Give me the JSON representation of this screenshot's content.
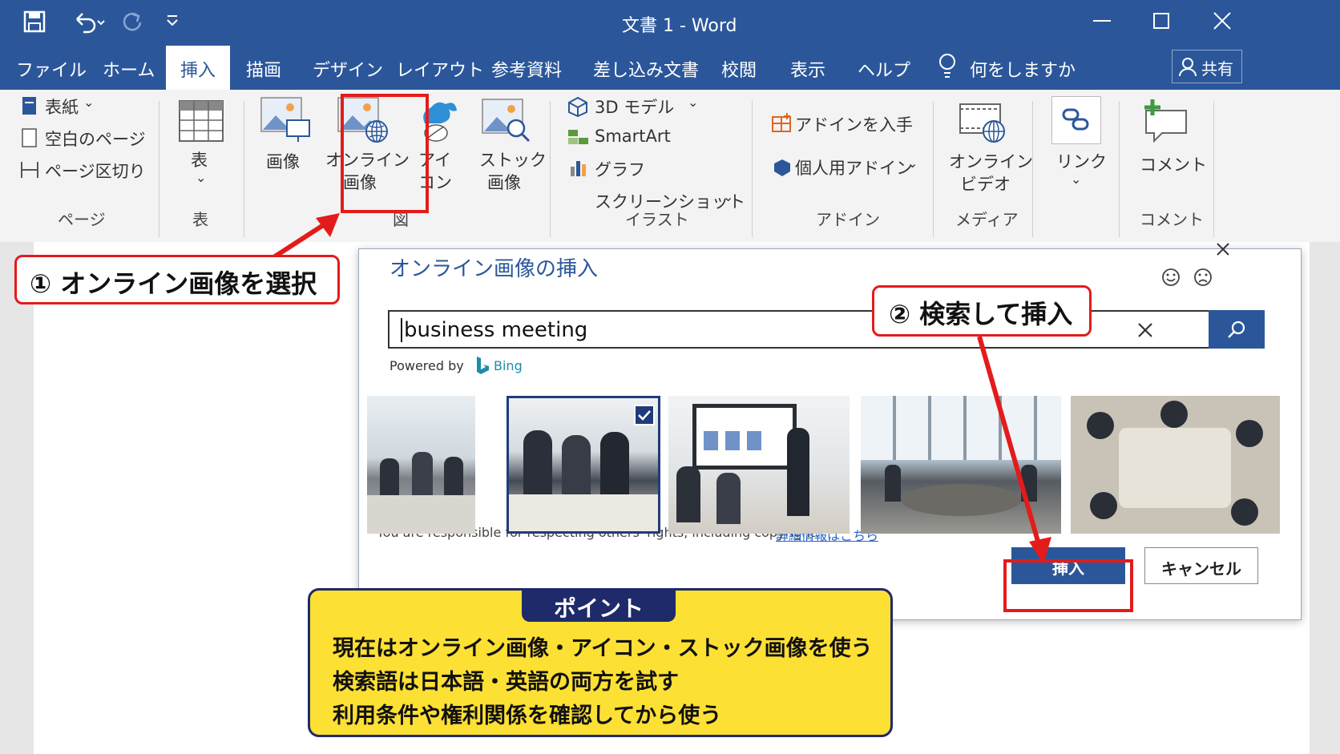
{
  "window": {
    "title": "文書 1  -  Word"
  },
  "tabs": [
    "ファイル",
    "ホーム",
    "挿入",
    "描画",
    "デザイン",
    "レイアウト",
    "参考資料",
    "差し込み文書",
    "校閲",
    "表示",
    "ヘルプ"
  ],
  "tell_me": "何をしますか",
  "share": "共有",
  "ribbon": {
    "page_group": {
      "cover": "表紙",
      "blank": "空白のページ",
      "break": "ページ区切り",
      "label": "ページ"
    },
    "table_group": {
      "button": "表",
      "label": "表"
    },
    "illus_group": {
      "image": "画像",
      "online1": "オンライン",
      "online2": "画像",
      "icon1": "アイ",
      "icon2": "コン",
      "stock1": "ストック",
      "stock2": "画像",
      "label": "図"
    },
    "illus2": {
      "model3d": "3D モデル",
      "smartart": "SmartArt",
      "chart": "グラフ",
      "screenshot": "スクリーンショット",
      "label": "イラスト"
    },
    "addin_group": {
      "get": "アドインを入手",
      "my": "個人用アドイン",
      "label": "アドイン"
    },
    "media_group": {
      "video1": "オンライン",
      "video2": "ビデオ",
      "label": "メディア"
    },
    "link_group": {
      "link": "リンク"
    },
    "comment_group": {
      "comment": "コメント",
      "label": "コメント"
    }
  },
  "dialog": {
    "title": "オンライン画像の挿入",
    "search_value": "business meeting",
    "powered_by": "Powered by",
    "bing": "Bing",
    "notice": "You are responsible for respecting others' rights, including copyright.",
    "more_link": "詳細情報はこちら",
    "insert": "挿入",
    "cancel": "キャンセル"
  },
  "callouts": {
    "step1": "① オンライン画像を選択",
    "step2": "② 検索して挿入"
  },
  "point": {
    "title": "ポイント",
    "lines": [
      "現在はオンライン画像・アイコン・ストック画像を使う",
      "検索語は日本語・英語の両方を試す",
      "利用条件や権利関係を確認してから使う"
    ]
  },
  "colors": {
    "word_blue": "#2b579a",
    "red": "#e41b1b",
    "point_yellow": "#fde034",
    "point_navy": "#1f2a6b"
  }
}
